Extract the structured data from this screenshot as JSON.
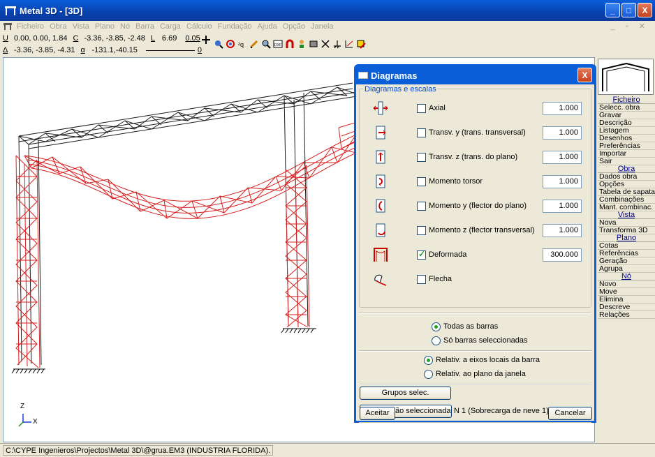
{
  "window": {
    "title": "Metal 3D - [3D]",
    "minimize": "_",
    "maximize": "□",
    "close": "X"
  },
  "menu": {
    "items": [
      "Ficheiro",
      "Obra",
      "Vista",
      "Plano",
      "Nó",
      "Barra",
      "Carga",
      "Cálculo",
      "Fundação",
      "Ajuda",
      "Opção",
      "Janela"
    ]
  },
  "toolbar": {
    "row1": {
      "u_label": "U",
      "u_value": "0.00, 0.00, 1.84",
      "c_label": "C",
      "c_value": "-3.36, -3.85, -2.48",
      "l_label": "L",
      "l_value": "6.69",
      "extra": "0.05"
    },
    "row2": {
      "delta_label": "Δ",
      "delta_value": "-3.36, -3.85, -4.31",
      "alpha_label": "α",
      "alpha_value": "-131.1,-40.15",
      "extra": "0"
    }
  },
  "axes": {
    "z": "Z",
    "x": "X"
  },
  "right_panel": {
    "sections": [
      {
        "header": "Ficheiro",
        "items": [
          "Selecc. obra",
          "Gravar",
          "Descrição",
          "Listagem",
          "Desenhos",
          "Preferências",
          "Importar",
          "Sair"
        ]
      },
      {
        "header": "Obra",
        "items": [
          "Dados obra",
          "Opções",
          "Tabela de sapatas",
          "Combinações",
          "Mant. combinac."
        ]
      },
      {
        "header": "Vista",
        "items": [
          "Nova",
          "Transforma 3D"
        ]
      },
      {
        "header": "Plano",
        "items": [
          "Cotas",
          "Referências",
          "Geração",
          "Agrupa"
        ]
      },
      {
        "header": "Nó",
        "items": [
          "Novo",
          "Move",
          "Elimina",
          "Descreve",
          "Relações"
        ]
      }
    ]
  },
  "status": {
    "path": "C:\\CYPE Ingenieros\\Projectos\\Metal 3D\\@grua.EM3 (INDUSTRIA FLORIDA)."
  },
  "dialog": {
    "title": "Diagramas",
    "close": "X",
    "group_label": "Diagramas e escalas",
    "rows": [
      {
        "label": "Axial",
        "checked": false,
        "value": "1.000",
        "icon": "axial-icon"
      },
      {
        "label": "Transv. y (trans. transversal)",
        "checked": false,
        "value": "1.000",
        "icon": "shear-y-icon"
      },
      {
        "label": "Transv. z (trans. do plano)",
        "checked": false,
        "value": "1.000",
        "icon": "shear-z-icon"
      },
      {
        "label": "Momento torsor",
        "checked": false,
        "value": "1.000",
        "icon": "torsion-icon"
      },
      {
        "label": "Momento y (flector do plano)",
        "checked": false,
        "value": "1.000",
        "icon": "moment-y-icon"
      },
      {
        "label": "Momento z (flector transversal)",
        "checked": false,
        "value": "1.000",
        "icon": "moment-z-icon"
      },
      {
        "label": "Deformada",
        "checked": true,
        "value": "300.000",
        "icon": "deformed-icon"
      },
      {
        "label": "Flecha",
        "checked": false,
        "value": "",
        "icon": "deflection-icon"
      }
    ],
    "scope_options": {
      "all": "Todas as barras",
      "selected": "Só barras seleccionadas",
      "active": "all"
    },
    "axis_options": {
      "local": "Relativ. a eixos locais da barra",
      "window": "Relativ. ao plano da janela",
      "active": "local"
    },
    "groups_button": "Grupos selec.",
    "combination_button": "Combinação seleccionada",
    "combination_text": "N 1 (Sobrecarga de neve 1)",
    "accept": "Aceitar",
    "cancel": "Cancelar"
  }
}
